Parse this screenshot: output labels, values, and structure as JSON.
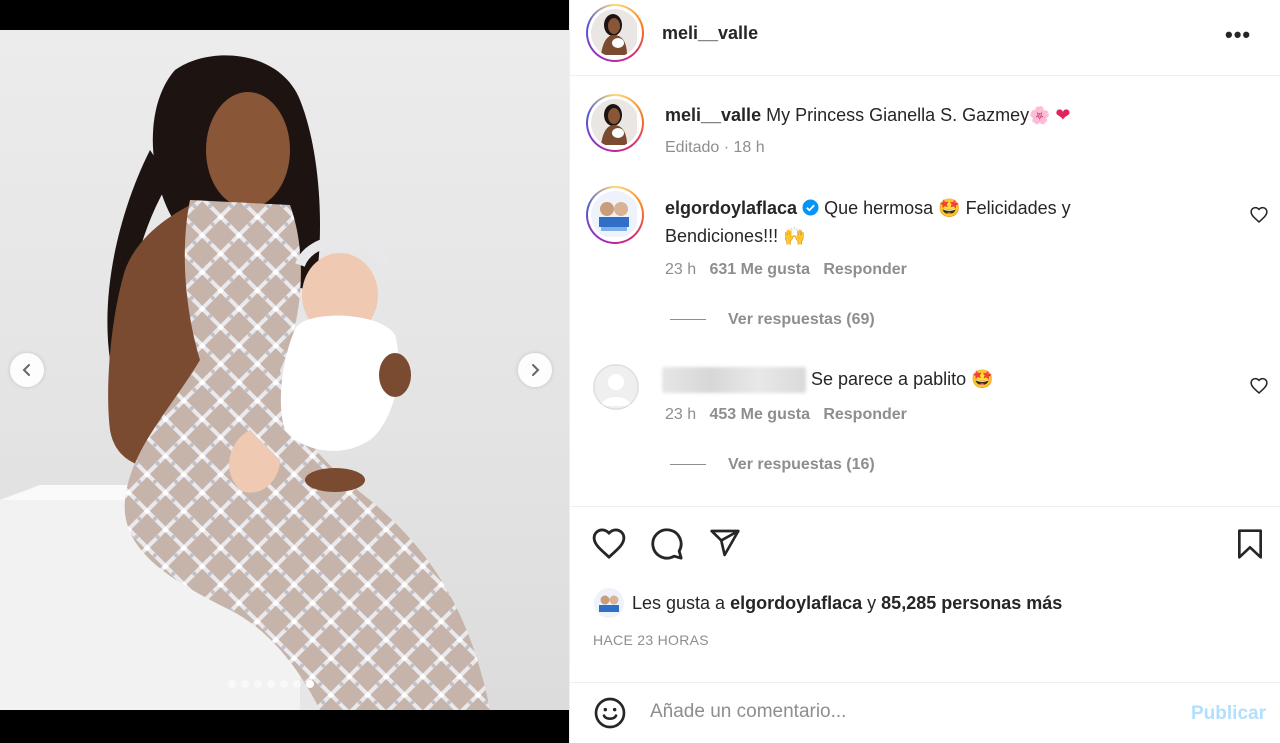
{
  "post": {
    "username": "meli__valle",
    "more_icon": "more-horizontal-icon",
    "caption": {
      "username": "meli__valle",
      "text": "My Princess Gianella S. Gazmey",
      "emojis": [
        "cherry-blossom",
        "heart"
      ],
      "edited_label": "Editado · 18 h"
    },
    "media": {
      "carousel_count": 7,
      "active_index": 6
    }
  },
  "comments": [
    {
      "username": "elgordoylaflaca",
      "verified": true,
      "text_line1": "Que hermosa",
      "emoji1": "🤩",
      "text_line1b": "Felicidades y",
      "text_line2": "Bendiciones!!!",
      "emoji2": "🙌",
      "time": "23 h",
      "likes": "631 Me gusta",
      "reply": "Responder",
      "view_replies": "Ver respuestas (69)"
    },
    {
      "username": "",
      "text": "Se parece a pablito",
      "emoji": "🤩",
      "time": "23 h",
      "likes": "453 Me gusta",
      "reply": "Responder",
      "view_replies": "Ver respuestas (16)"
    }
  ],
  "footer": {
    "likes_prefix": "Les gusta a",
    "likes_user": "elgordoylaflaca",
    "likes_joiner": "y",
    "likes_rest": "85,285 personas más",
    "time_ago": "HACE 23 HORAS",
    "comment_placeholder": "Añade un comentario...",
    "publish_label": "Publicar"
  },
  "colors": {
    "text": "#262626",
    "secondary": "#8e8e8e",
    "verified": "#0095f6",
    "publish_disabled": "#b2dffc"
  }
}
